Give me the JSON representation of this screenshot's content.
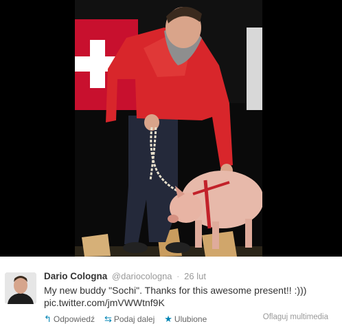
{
  "tweet": {
    "full_name": "Dario Cologna",
    "screen_name": "@dariocologna",
    "separator": "·",
    "timestamp": "26 lut",
    "text": "My new buddy \"Sochi\". Thanks for this awesome present!! :)))",
    "link": "pic.twitter.com/jmVWWtnf9K"
  },
  "actions": {
    "reply_label": "Odpowiedź",
    "retweet_label": "Podaj dalej",
    "favorite_label": "Ulubione",
    "reply_icon": "↰",
    "retweet_icon": "⇆",
    "favorite_icon": "★"
  },
  "flag_media_label": "Oflaguj multimedia",
  "icons": {
    "reply": "reply-icon",
    "retweet": "retweet-icon",
    "favorite": "star-icon"
  },
  "colors": {
    "link_blue": "#0084b4",
    "name": "#333333",
    "meta": "#999999"
  }
}
